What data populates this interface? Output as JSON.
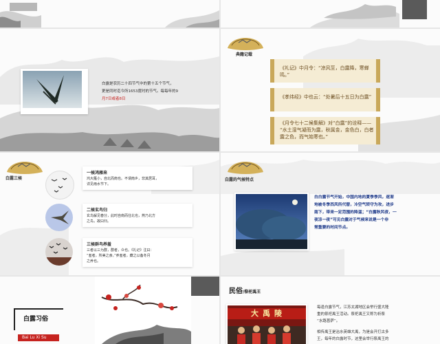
{
  "colors": {
    "red": "#c6231f",
    "gold": "#c9a85a",
    "ink": "#2b2b2b"
  },
  "s3": {
    "para1": "白露是农历二十四节气中的第十五个节气，",
    "para2": "更是同时迄今所1653度时的节气。每每年的9",
    "para3": "月7日或者8日"
  },
  "s4": {
    "title": "典籍记载",
    "item1": "《礼记》中月令：“凉风至，白露降，寒蝉鸣。”",
    "item2": "《孝纬经》中也云：“处暑后十五日为白露”",
    "item3a": "《月令七十二候集解》对“白露”的诠释——",
    "item3b": "“水土湿气凝而为露，秋属金，金色白，白者",
    "item3c": "露之色，而气始寒也。”"
  },
  "s5": {
    "side_title": "白露三候",
    "h1": "一候鸿雁来",
    "d1a": "鸿大雁小，自北而南也。不谓南乡，非其居耳，",
    "d1b": "详见雨水节下。",
    "h2": "二候玄鸟归",
    "d2a": "玄鸟解见春分，此时自南而往北也，燕乃北方",
    "d2b": "之鸟，故曰归。",
    "h3": "三候群鸟养羞",
    "d3a": "三者以三为群，群者，众也。《礼记》注曰：",
    "d3b": "“羞者，所美之食。”养羞者，藏之以备冬月",
    "d3c": "之养也。"
  },
  "s6": {
    "title": "白露的气候特点",
    "p1": "白白露节气开始，中国内地的夏季季风，逐渐",
    "p2": "地被冬季西风所代替，冷空气转守为攻，进步",
    "p3": "南下，带来一定范围的降温；“白露秋风夜，一",
    "p4": "夜凉一夜”可见白露对于气候来说是一个非",
    "p5": "常重要的时间节点。"
  },
  "s7": {
    "title": "白露习俗",
    "pinyin": "Bai Lu Xi Su"
  },
  "s8": {
    "title_main": "民俗",
    "title_sub": "/祭祀禹王",
    "banner": "大禹陵",
    "p1": "每逢白露节气，江苏太湖地区会举行盛大隆",
    "p2": "重的祭祀禹王活动。祭祀禹王又称为祈祭",
    "p3": "“水路菩萨”。",
    "p4": "相传禹王是治水英雄大禹，为是会开打古多",
    "p5": "王，每年的白露时节，这里会举行祭禹王的"
  }
}
